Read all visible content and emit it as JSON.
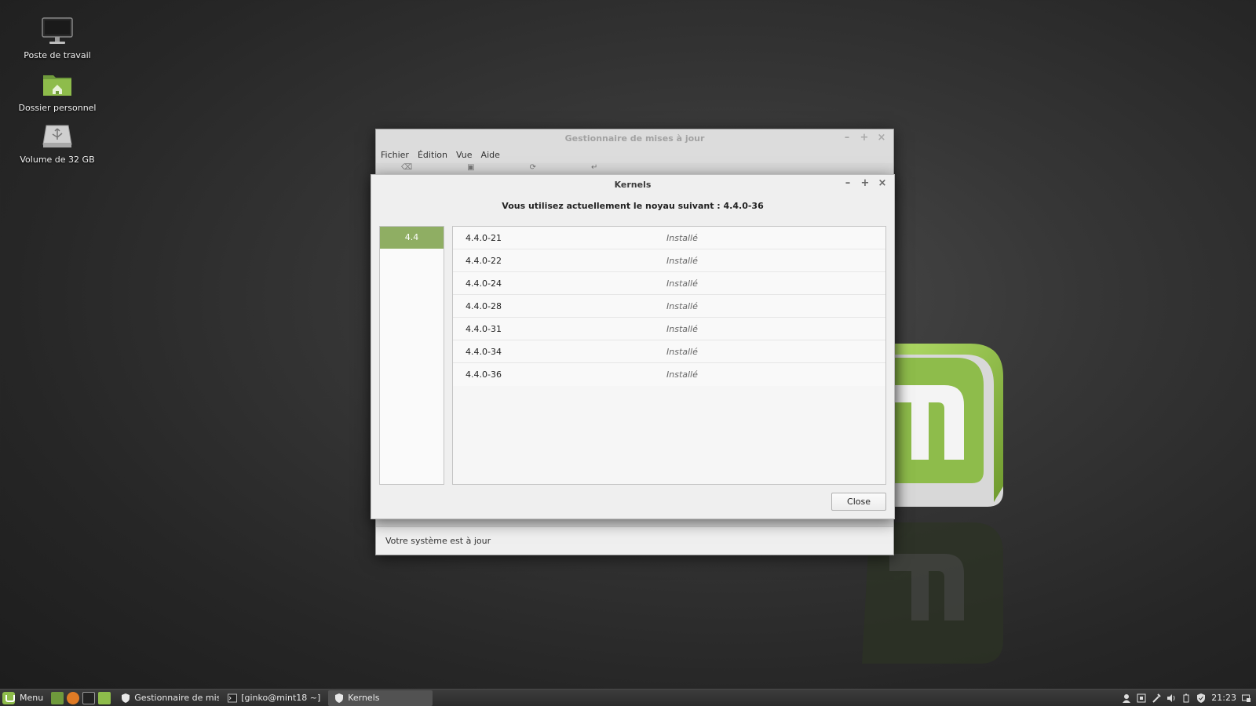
{
  "desktop": {
    "icons": [
      {
        "label": "Poste de travail",
        "icon": "computer-icon"
      },
      {
        "label": "Dossier personnel",
        "icon": "home-folder-icon"
      },
      {
        "label": "Volume de 32 GB",
        "icon": "usb-drive-icon"
      }
    ]
  },
  "update_manager": {
    "title": "Gestionnaire de mises à jour",
    "menu": [
      "Fichier",
      "Édition",
      "Vue",
      "Aide"
    ],
    "status": "Votre système est à jour"
  },
  "kernels": {
    "title": "Kernels",
    "current_kernel_text": "Vous utilisez actuellement le noyau suivant : 4.4.0-36",
    "series": [
      "4.4"
    ],
    "rows": [
      {
        "version": "4.4.0-21",
        "status": "Installé"
      },
      {
        "version": "4.4.0-22",
        "status": "Installé"
      },
      {
        "version": "4.4.0-24",
        "status": "Installé"
      },
      {
        "version": "4.4.0-28",
        "status": "Installé"
      },
      {
        "version": "4.4.0-31",
        "status": "Installé"
      },
      {
        "version": "4.4.0-34",
        "status": "Installé"
      },
      {
        "version": "4.4.0-36",
        "status": "Installé"
      }
    ],
    "close_label": "Close"
  },
  "taskbar": {
    "menu_label": "Menu",
    "tasks": [
      {
        "label": "Gestionnaire de mis...",
        "icon": "shield-icon"
      },
      {
        "label": "[ginko@mint18 ~]",
        "icon": "terminal-icon"
      },
      {
        "label": "Kernels",
        "icon": "shield-icon"
      }
    ],
    "clock": "21:23"
  },
  "colors": {
    "accent": "#8fae63",
    "mint_green": "#8ebc4b"
  }
}
